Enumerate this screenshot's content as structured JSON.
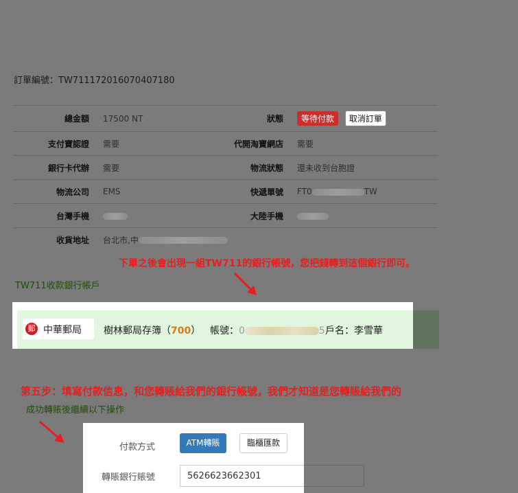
{
  "order": {
    "label": "訂單編號：",
    "number": "TW711172016070407180"
  },
  "info": {
    "total_label": "總金額",
    "total_value": "17500 NT",
    "status_label": "狀態",
    "status_value": "等待付款",
    "cancel_label": "取消訂單",
    "pay_verify_label": "支付寶認證",
    "pay_verify_value": "需要",
    "taobao_label": "代開淘寶網店",
    "taobao_value": "需要",
    "card_label": "銀行卡代辦",
    "card_value": "需要",
    "logistics_label": "物流狀態",
    "logistics_value": "還未收到台胞證",
    "company_label": "物流公司",
    "company_value": "EMS",
    "express_label": "快遞單號",
    "express_prefix": "FT0",
    "express_suffix": "TW",
    "tw_phone_label": "台灣手機",
    "cn_phone_label": "大陸手機",
    "address_label": "收貨地址",
    "address_prefix": "台北市,中"
  },
  "annotations": {
    "note1": "下單之後會出現一組TW711的銀行帳號，您把錢轉到這個銀行即可。",
    "note2": "第五步：填寫付款信息，和您轉賬給我們的銀行帳號，我們才知道是您轉賬給我們的"
  },
  "bank": {
    "section_label": "TW711收款銀行帳戶",
    "logo_text": "中華郵局",
    "passbook_label": "樹林郵局存簿（",
    "passbook_code": "700",
    "passbook_close": "）",
    "account_label": "帳號：",
    "account_prefix": "0",
    "account_suffix": "5",
    "holder": "戶名：李雪華"
  },
  "form": {
    "success_note": "成功轉賬後繼續以下操作",
    "method_label": "付款方式",
    "atm_label": "ATM轉賬",
    "cash_label": "臨櫃匯款",
    "account_label": "轉賬銀行賬號",
    "account_value": "5626623662301"
  },
  "colors": {
    "status_badge": "#c9302c",
    "atm_button": "#337ab7",
    "annotation": "#e51f1f",
    "bank_bg": "#e2f5de"
  }
}
